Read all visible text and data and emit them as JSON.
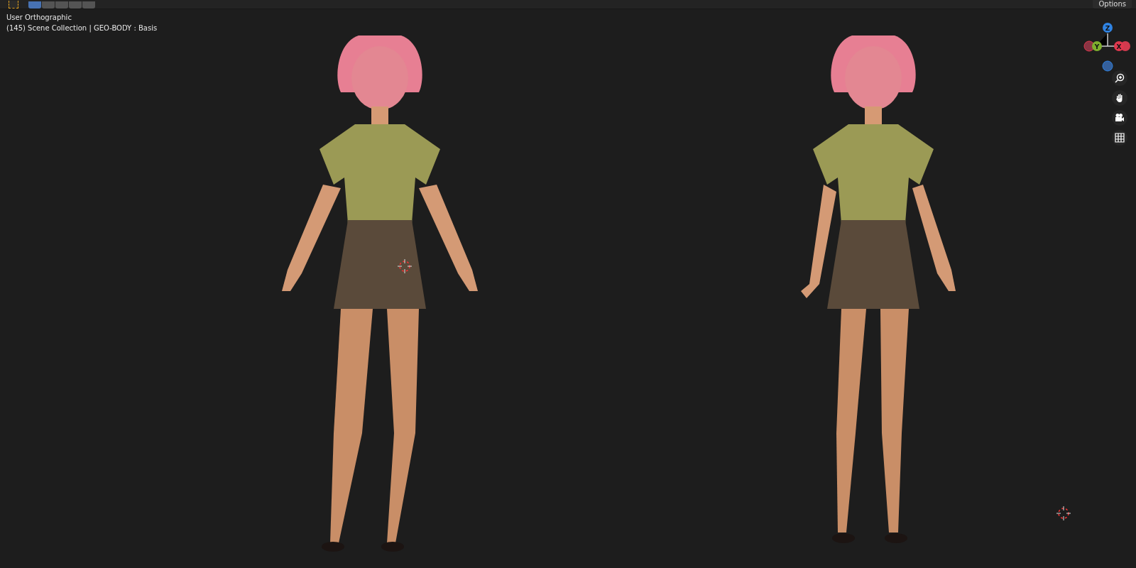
{
  "header": {
    "select_modes": [
      {
        "selected": true
      },
      {
        "selected": false
      },
      {
        "selected": false
      },
      {
        "selected": false
      },
      {
        "selected": false
      }
    ],
    "options_button": "Options"
  },
  "viewport": {
    "view_name": "User Orthographic",
    "context": "(145) Scene Collection | GEO-BODY : Basis",
    "figures": [
      {
        "turned": false
      },
      {
        "turned": true
      }
    ],
    "gizmo_axes": [
      {
        "label": "Z"
      },
      {
        "label": "Y"
      },
      {
        "label": "X"
      }
    ]
  }
}
